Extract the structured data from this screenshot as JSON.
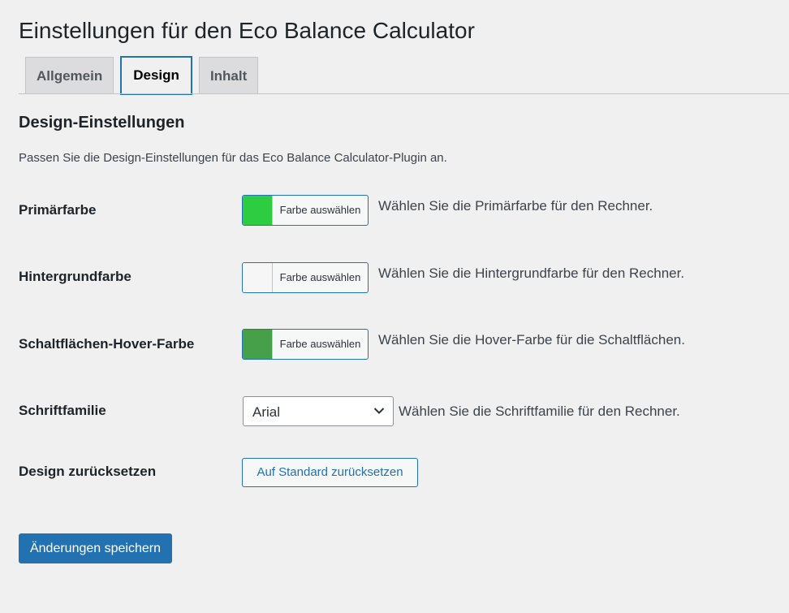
{
  "page": {
    "title": "Einstellungen für den Eco Balance Calculator"
  },
  "tabs": [
    {
      "label": "Allgemein",
      "active": false
    },
    {
      "label": "Design",
      "active": true
    },
    {
      "label": "Inhalt",
      "active": false
    }
  ],
  "section": {
    "title": "Design-Einstellungen",
    "description": "Passen Sie die Design-Einstellungen für das Eco Balance Calculator-Plugin an."
  },
  "fields": {
    "primary": {
      "label": "Primärfarbe",
      "button_label": "Farbe auswählen",
      "color": "#2ecc40",
      "description": "Wählen Sie die Primärfarbe für den Rechner."
    },
    "background": {
      "label": "Hintergrundfarbe",
      "button_label": "Farbe auswählen",
      "color": "#f6f6f6",
      "description": "Wählen Sie die Hintergrundfarbe für den Rechner."
    },
    "hover": {
      "label": "Schaltflächen-Hover-Farbe",
      "button_label": "Farbe auswählen",
      "color": "#45a049",
      "description": "Wählen Sie die Hover-Farbe für die Schaltflächen."
    },
    "font": {
      "label": "Schriftfamilie",
      "selected": "Arial",
      "description": "Wählen Sie die Schriftfamilie für den Rechner."
    },
    "reset": {
      "label": "Design zurücksetzen",
      "button_label": "Auf Standard zurücksetzen"
    }
  },
  "actions": {
    "save_label": "Änderungen speichern"
  }
}
